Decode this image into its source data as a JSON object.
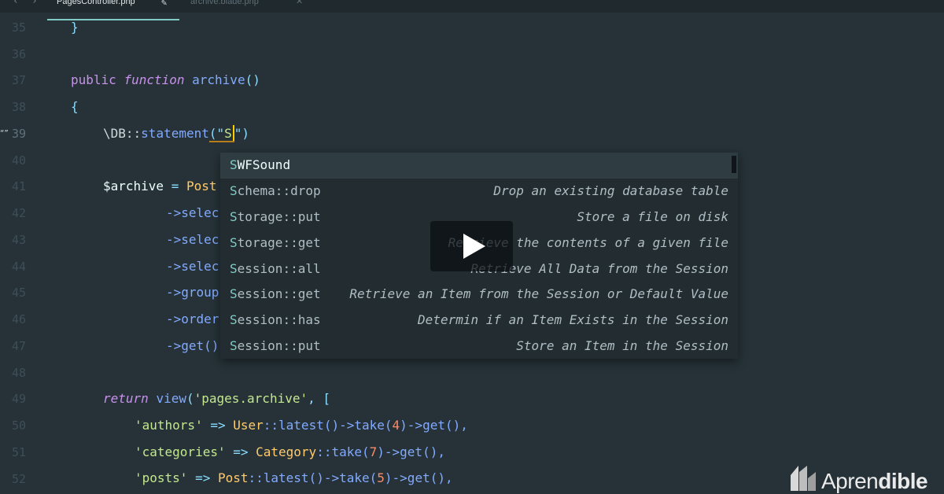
{
  "tabs": [
    {
      "label": "PagesController.php",
      "active": true
    },
    {
      "label": "archive.blade.php",
      "active": false
    }
  ],
  "line_numbers": [
    "35",
    "36",
    "37",
    "38",
    "39",
    "40",
    "41",
    "42",
    "43",
    "44",
    "45",
    "46",
    "47",
    "48",
    "49",
    "50",
    "51",
    "52"
  ],
  "active_line": "39",
  "gutter_mark": "“”",
  "code": {
    "l35_brace": "}",
    "l37_kw": "public",
    "l37_fn_kw": "function",
    "l37_name": "archive",
    "l37_parens": "()",
    "l38_brace": "{",
    "l39_ns": "\\DB::",
    "l39_call": "statement",
    "l39_open": "(\"",
    "l39_typed": "S",
    "l39_close": "\")",
    "l41_var": "$archive",
    "l41_eq": " = ",
    "l41_cls": "Post",
    "l42": "->selec",
    "l43": "->selec",
    "l44": "->selec",
    "l45": "->group",
    "l46": "->order",
    "l47": "->get()",
    "l49_kw": "return",
    "l49_fn": "view",
    "l49_open": "(",
    "l49_str": "'pages.archive'",
    "l49_rest": ", [",
    "l50_key": "'authors'",
    "l50_arrow": " => ",
    "l50_cls": "User",
    "l50_a": "::latest()->take(",
    "l50_num": "4",
    "l50_b": ")->get(),",
    "l51_key": "'categories'",
    "l51_arrow": " => ",
    "l51_cls": "Category",
    "l51_a": "::take(",
    "l51_num": "7",
    "l51_b": ")->get(),",
    "l52_key": "'posts'",
    "l52_arrow": " => ",
    "l52_cls": "Post",
    "l52_a": "::latest()->take(",
    "l52_num": "5",
    "l52_b": ")->get(),"
  },
  "autocomplete": {
    "items": [
      {
        "match": "S",
        "rest": "WFSound",
        "desc": ""
      },
      {
        "match": "S",
        "rest": "chema::drop",
        "desc": "Drop an existing database table"
      },
      {
        "match": "S",
        "rest": "torage::put",
        "desc": "Store a file on disk"
      },
      {
        "match": "S",
        "rest": "torage::get",
        "desc": "Retrieve the contents of a given file"
      },
      {
        "match": "S",
        "rest": "ession::all",
        "desc": "Retrieve All Data from the Session"
      },
      {
        "match": "S",
        "rest": "ession::get",
        "desc": "Retrieve an Item from the Session or Default Value"
      },
      {
        "match": "S",
        "rest": "ession::has",
        "desc": "Determin if an Item Exists in the Session"
      },
      {
        "match": "S",
        "rest": "ession::put",
        "desc": "Store an Item in the Session"
      }
    ]
  },
  "logo": {
    "part1": "Apren",
    "part2": "dible"
  },
  "icons": {
    "back": "chevron-left-icon",
    "forward": "chevron-right-icon",
    "edit": "pencil-icon",
    "close": "close-icon",
    "play": "play-icon"
  },
  "colors": {
    "background": "#263238",
    "accent": "#80cbc4",
    "caret": "#ffcc00"
  }
}
